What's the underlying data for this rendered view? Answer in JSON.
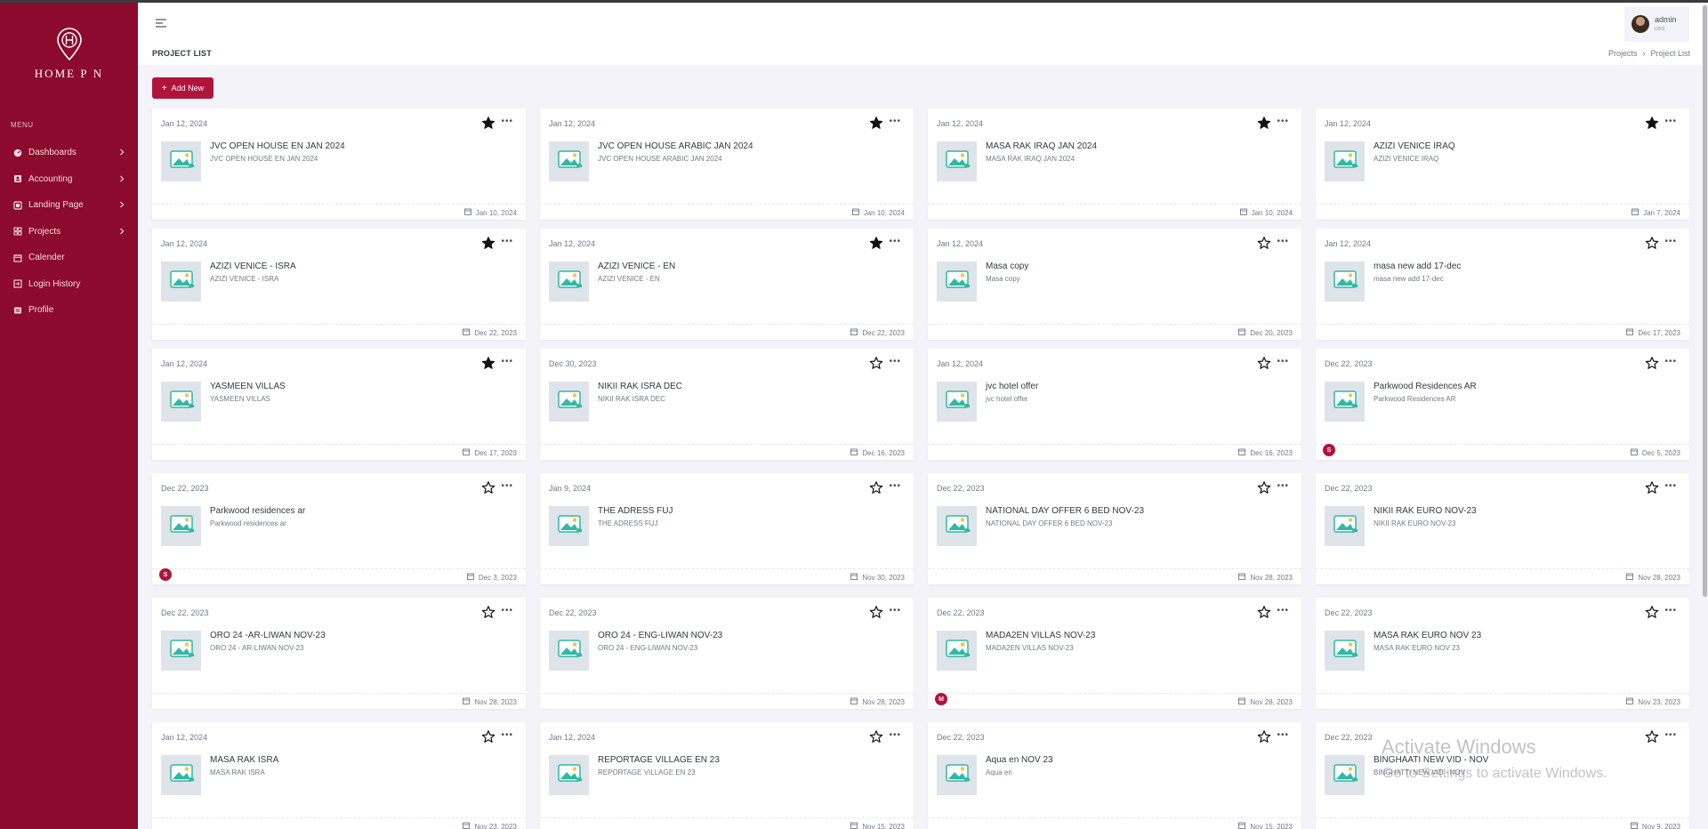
{
  "sidebar": {
    "logo_text": "HOME P N",
    "menu_title": "MENU",
    "items": [
      {
        "label": "Dashboards",
        "icon": "dashboard-icon",
        "has_chevron": true
      },
      {
        "label": "Accounting",
        "icon": "accounting-icon",
        "has_chevron": true
      },
      {
        "label": "Landing Page",
        "icon": "landing-page-icon",
        "has_chevron": true
      },
      {
        "label": "Projects",
        "icon": "projects-icon",
        "has_chevron": true
      },
      {
        "label": "Calender",
        "icon": "calendar-icon",
        "has_chevron": false
      },
      {
        "label": "Login History",
        "icon": "login-history-icon",
        "has_chevron": false
      },
      {
        "label": "Profile",
        "icon": "profile-icon",
        "has_chevron": false
      }
    ]
  },
  "header": {
    "user_name": "admin",
    "user_role": "ceo"
  },
  "page": {
    "title": "PROJECT LIST",
    "breadcrumb": [
      "Projects",
      "Project List"
    ],
    "add_button": "Add New"
  },
  "cards": [
    {
      "created": "Jan 12, 2024",
      "starred": true,
      "name": "JVC OPEN HOUSE EN JAN 2024",
      "sub": "JVC OPEN HOUSE EN JAN 2024",
      "date": "Jan 10, 2024",
      "badge": ""
    },
    {
      "created": "Jan 12, 2024",
      "starred": true,
      "name": "JVC OPEN HOUSE ARABIC JAN 2024",
      "sub": "JVC OPEN HOUSE ARABIC JAN 2024",
      "date": "Jan 10, 2024",
      "badge": ""
    },
    {
      "created": "Jan 12, 2024",
      "starred": true,
      "name": "MASA RAK IRAQ JAN 2024",
      "sub": "MASA RAK IRAQ JAN 2024",
      "date": "Jan 10, 2024",
      "badge": ""
    },
    {
      "created": "Jan 12, 2024",
      "starred": true,
      "name": "AZIZI VENICE IRAQ",
      "sub": "AZIZI VENICE IRAQ",
      "date": "Jan 7, 2024",
      "badge": ""
    },
    {
      "created": "Jan 12, 2024",
      "starred": true,
      "name": "AZIZI VENICE - ISRA",
      "sub": "AZIZI VENICE - ISRA",
      "date": "Dec 22, 2023",
      "badge": ""
    },
    {
      "created": "Jan 12, 2024",
      "starred": true,
      "name": "AZIZI VENICE - EN",
      "sub": "AZIZI VENICE - EN",
      "date": "Dec 22, 2023",
      "badge": ""
    },
    {
      "created": "Jan 12, 2024",
      "starred": false,
      "name": "Masa copy",
      "sub": "Masa copy",
      "date": "Dec 20, 2023",
      "badge": ""
    },
    {
      "created": "Jan 12, 2024",
      "starred": false,
      "name": "masa new add 17-dec",
      "sub": "masa new add 17-dec",
      "date": "Dec 17, 2023",
      "badge": ""
    },
    {
      "created": "Jan 12, 2024",
      "starred": true,
      "name": "YASMEEN VILLAS",
      "sub": "YASMEEN VILLAS",
      "date": "Dec 17, 2023",
      "badge": ""
    },
    {
      "created": "Dec 30, 2023",
      "starred": false,
      "name": "NIKII RAK ISRA DEC",
      "sub": "NIKII RAK ISRA DEC",
      "date": "Dec 16, 2023",
      "badge": ""
    },
    {
      "created": "Jan 12, 2024",
      "starred": false,
      "name": "jvc hotel offer",
      "sub": "jvc hotel offer",
      "date": "Dec 16, 2023",
      "badge": ""
    },
    {
      "created": "Dec 22, 2023",
      "starred": false,
      "name": "Parkwood Residences AR",
      "sub": "Parkwood Residences AR",
      "date": "Dec 5, 2023",
      "badge": "S"
    },
    {
      "created": "Dec 22, 2023",
      "starred": false,
      "name": "Parkwood residences ar",
      "sub": "Parkwood residences ar",
      "date": "Dec 3, 2023",
      "badge": "S"
    },
    {
      "created": "Jan 9, 2024",
      "starred": false,
      "name": "THE ADRESS FUJ",
      "sub": "THE ADRESS FUJ",
      "date": "Nov 30, 2023",
      "badge": ""
    },
    {
      "created": "Dec 22, 2023",
      "starred": false,
      "name": "NATIONAL DAY OFFER 6 BED NOV-23",
      "sub": "NATIONAL DAY OFFER 6 BED NOV-23",
      "date": "Nov 28, 2023",
      "badge": ""
    },
    {
      "created": "Dec 22, 2023",
      "starred": false,
      "name": "NIKII RAK EURO NOV-23",
      "sub": "NIKII RAK EURO NOV-23",
      "date": "Nov 28, 2023",
      "badge": ""
    },
    {
      "created": "Dec 22, 2023",
      "starred": false,
      "name": "ORO 24 -AR-LIWAN NOV-23",
      "sub": "ORO 24 - AR-LIWAN NOV-23",
      "date": "Nov 28, 2023",
      "badge": ""
    },
    {
      "created": "Dec 22, 2023",
      "starred": false,
      "name": "ORO 24 - ENG-LIWAN NOV-23",
      "sub": "ORO 24 - ENG-LIWAN NOV-23",
      "date": "Nov 28, 2023",
      "badge": ""
    },
    {
      "created": "Dec 22, 2023",
      "starred": false,
      "name": "MADA2EN VILLAS NOV-23",
      "sub": "MADA2EN VILLAS NOV-23",
      "date": "Nov 28, 2023",
      "badge": "M"
    },
    {
      "created": "Dec 22, 2023",
      "starred": false,
      "name": "MASA RAK EURO NOV 23",
      "sub": "MASA RAK EURO NOV 23",
      "date": "Nov 23, 2023",
      "badge": ""
    },
    {
      "created": "Jan 12, 2024",
      "starred": false,
      "name": "MASA RAK ISRA",
      "sub": "MASA RAK ISRA",
      "date": "Nov 23, 2023",
      "badge": ""
    },
    {
      "created": "Jan 12, 2024",
      "starred": false,
      "name": "REPORTAGE VILLAGE EN 23",
      "sub": "REPORTAGE VILLAGE EN 23",
      "date": "Nov 15, 2023",
      "badge": ""
    },
    {
      "created": "Dec 22, 2023",
      "starred": false,
      "name": "Aqua en NOV 23",
      "sub": "Aqua en",
      "date": "Nov 15, 2023",
      "badge": ""
    },
    {
      "created": "Dec 22, 2023",
      "starred": false,
      "name": "BINGHAATI NEW VID - NOV",
      "sub": "BINGHATTI NEW VID - NOV",
      "date": "Nov 9, 2023",
      "badge": ""
    }
  ],
  "watermark": {
    "line1": "Activate Windows",
    "line2": "Go to Settings to activate Windows."
  },
  "colors": {
    "brand": "#8b0a2e",
    "accent": "#b0143c",
    "background": "#f3f3f9"
  }
}
